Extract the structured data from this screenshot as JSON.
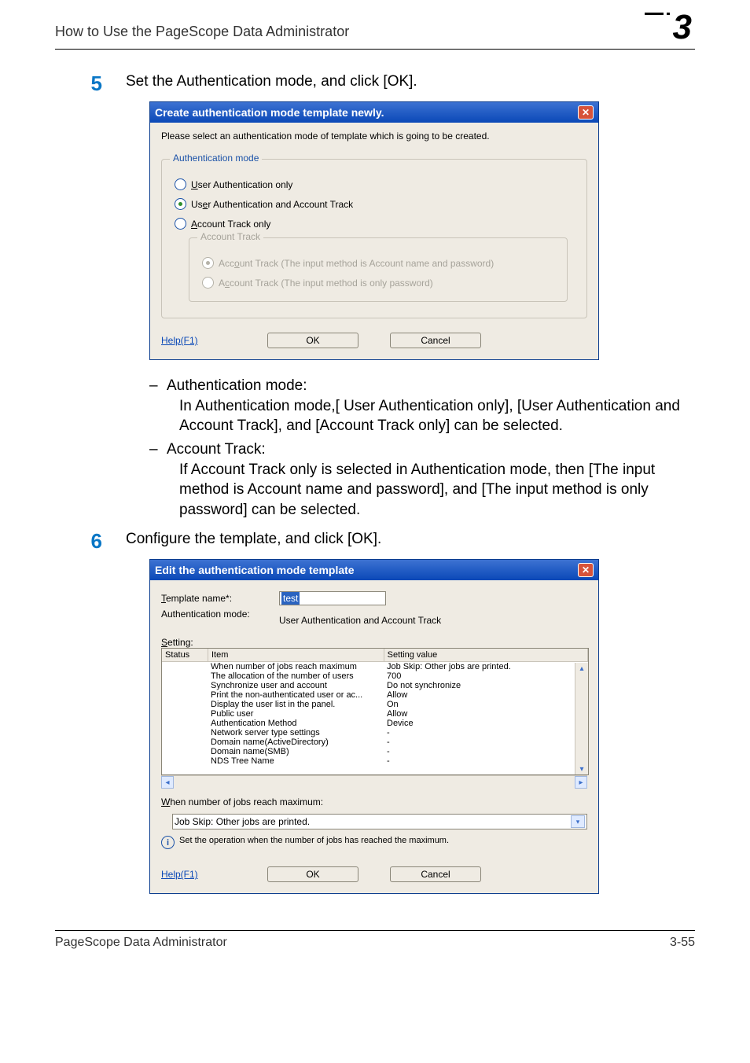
{
  "header": {
    "title": "How to Use the PageScope Data Administrator",
    "chapter": "3"
  },
  "step5": {
    "num": "5",
    "text": "Set the Authentication mode, and click [OK]."
  },
  "dialog1": {
    "title": "Create authentication mode template newly.",
    "intro": "Please select an authentication mode of template which is going to be created.",
    "group1_legend": "Authentication mode",
    "r_user_only_pre": "U",
    "r_user_only_rest": "ser Authentication only",
    "r_user_track_pre": "Us",
    "r_user_track_und": "e",
    "r_user_track_rest": "r Authentication and Account Track",
    "r_track_only_pre": "A",
    "r_track_only_rest": "ccount Track only",
    "group2_legend": "Account Track",
    "r_at_np_pre": "Acc",
    "r_at_np_und": "o",
    "r_at_np_rest": "unt Track (The input method is Account name and password)",
    "r_at_p_pre": "A",
    "r_at_p_und": "c",
    "r_at_p_rest": "count Track (The input method is only password)",
    "help": "Help(F1)",
    "ok": "OK",
    "cancel": "Cancel"
  },
  "notes": {
    "t1": "Authentication mode:",
    "d1": "In Authentication mode,[ User Authentication only], [User Authentication and Account Track], and [Account Track only] can be selected.",
    "t2": "Account Track:",
    "d2": "If Account Track only is selected in Authentication mode, then [The input method is Account name and password], and [The input method is only password] can be selected."
  },
  "step6": {
    "num": "6",
    "text": "Configure the template, and click [OK]."
  },
  "dialog2": {
    "title": "Edit the authentication mode template",
    "lbl_template_pre": "T",
    "lbl_template_rest": "emplate name*:",
    "template_value": "test",
    "lbl_authmode": "Authentication mode:",
    "authmode_value": "User Authentication and Account Track",
    "lbl_setting_pre": "S",
    "lbl_setting_rest": "etting:",
    "col_status": "Status",
    "col_item": "Item",
    "col_value": "Setting value",
    "rows": [
      {
        "item": "When number of jobs reach maximum",
        "value": "Job Skip: Other jobs are printed."
      },
      {
        "item": "The allocation of the number of users",
        "value": "700"
      },
      {
        "item": "Synchronize user and account",
        "value": "Do not synchronize"
      },
      {
        "item": "Print the non-authenticated user or ac...",
        "value": "Allow"
      },
      {
        "item": "Display the user list in the panel.",
        "value": "On"
      },
      {
        "item": "Public user",
        "value": "Allow"
      },
      {
        "item": "Authentication Method",
        "value": "Device"
      },
      {
        "item": "Network server type settings",
        "value": "-"
      },
      {
        "item": "Domain name(ActiveDirectory)",
        "value": "-"
      },
      {
        "item": "Domain name(SMB)",
        "value": "-"
      },
      {
        "item": "NDS Tree Name",
        "value": "-"
      }
    ],
    "sel_label_pre": "W",
    "sel_label_rest": "hen number of jobs reach maximum:",
    "dropdown_value": "Job Skip: Other jobs are printed.",
    "info": "Set the operation when the number of jobs has reached the maximum.",
    "help": "Help(F1)",
    "ok": "OK",
    "cancel": "Cancel"
  },
  "footer": {
    "left": "PageScope Data Administrator",
    "right": "3-55"
  }
}
